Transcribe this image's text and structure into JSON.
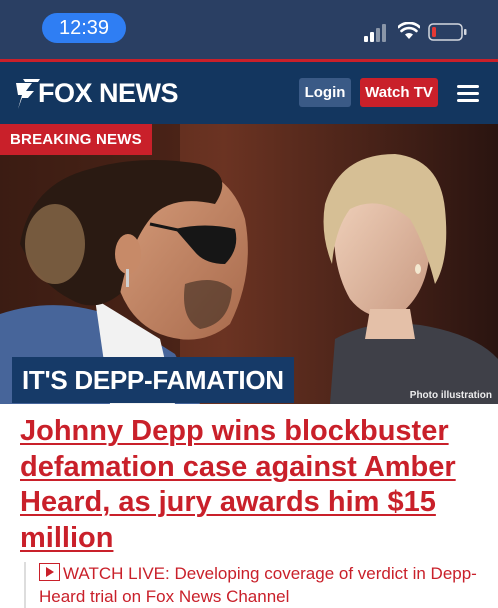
{
  "status_bar": {
    "time": "12:39"
  },
  "header": {
    "logo_text": "FOX NEWS",
    "login_label": "Login",
    "watch_tv_label": "Watch TV"
  },
  "hero": {
    "badge": "BREAKING NEWS",
    "caption": "IT'S DEPP-FAMATION",
    "photo_credit": "Photo illustration"
  },
  "article": {
    "headline": "Johnny Depp wins blockbuster defamation case against Amber Heard, as jury awards him $15 million",
    "watch_live": "WATCH LIVE: Developing coverage of verdict in Depp-Heard trial on Fox News Channel"
  },
  "colors": {
    "brand_red": "#c9202a",
    "brand_navy": "#13365f",
    "status_blue": "#2f7ef3"
  }
}
